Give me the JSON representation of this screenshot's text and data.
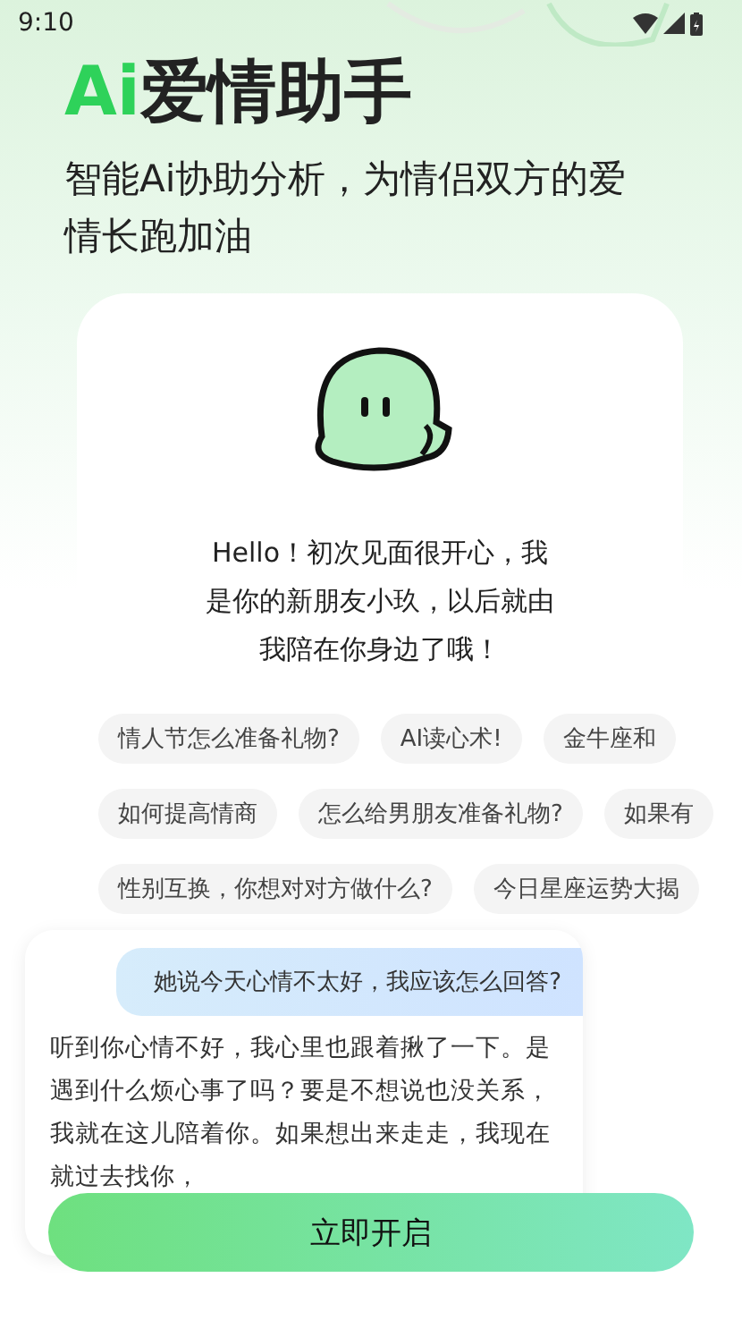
{
  "status_bar": {
    "time": "9:10"
  },
  "title": {
    "highlight": "Ai",
    "text": "爱情助手"
  },
  "subtitle": "智能Ai协助分析，为情侣双方的爱情长跑加油",
  "greeting": "Hello！初次见面很开心，我是你的新朋友小玖，以后就由我陪在你身边了哦！",
  "suggestion_rows": [
    [
      "情人节怎么准备礼物?",
      "AI读心术!",
      "金牛座和"
    ],
    [
      "如何提高情商",
      "怎么给男朋友准备礼物?",
      "如果有"
    ],
    [
      "性别互换，你想对对方做什么?",
      "今日星座运势大揭"
    ]
  ],
  "chat": {
    "question": "她说今天心情不太好，我应该怎么回答?",
    "answer": "听到你心情不好，我心里也跟着揪了一下。是遇到什么烦心事了吗？要是不想说也没关系，我就在这儿陪着你。如果想出来走走，我现在就过去找你，"
  },
  "button": "立即开启"
}
